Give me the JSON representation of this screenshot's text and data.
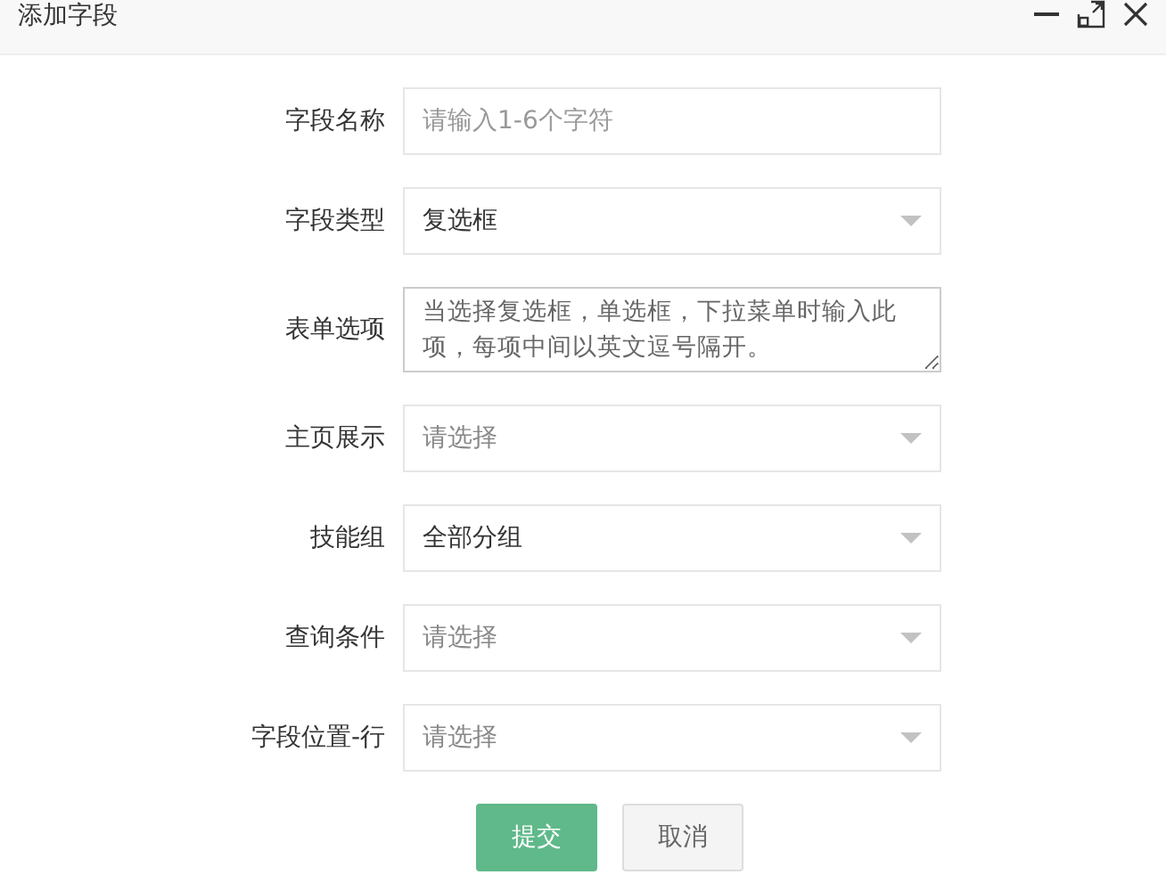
{
  "window": {
    "title": "添加字段"
  },
  "fields": [
    {
      "label": "字段名称",
      "kind": "text",
      "placeholder": "请输入1-6个字符"
    },
    {
      "label": "字段类型",
      "kind": "select",
      "value": "复选框"
    },
    {
      "label": "表单选项",
      "kind": "textarea",
      "placeholder": "当选择复选框，单选框，下拉菜单时输入此项，每项中间以英文逗号隔开。"
    },
    {
      "label": "主页展示",
      "kind": "select",
      "placeholder": "请选择"
    },
    {
      "label": "技能组",
      "kind": "select",
      "value": "全部分组"
    },
    {
      "label": "查询条件",
      "kind": "select",
      "placeholder": "请选择"
    },
    {
      "label": "字段位置-行",
      "kind": "select",
      "placeholder": "请选择"
    }
  ],
  "buttons": [
    {
      "label": "提交",
      "kind": "primary"
    },
    {
      "label": "取消",
      "kind": "default"
    }
  ]
}
